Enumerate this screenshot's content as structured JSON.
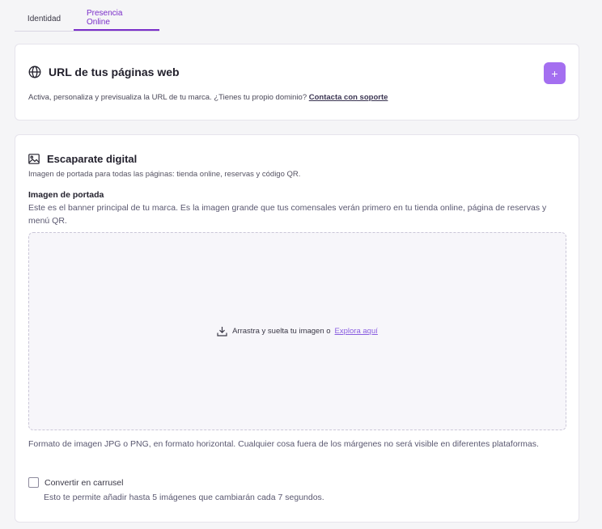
{
  "tabs": [
    {
      "label": "Identidad",
      "active": false
    },
    {
      "label": "Presencia Online",
      "active": true
    }
  ],
  "url_card": {
    "icon": "globe-icon",
    "title": "URL de tus páginas web",
    "add_button_label": "+",
    "description": "Activa, personaliza y previsualiza la URL de tu marca. ¿Tienes tu propio dominio?",
    "support_link": "Contacta con soporte"
  },
  "storefront_card": {
    "icon": "image-icon",
    "title": "Escaparate digital",
    "subtitle": "Imagen de portada para todas las páginas: tienda online, reservas y código QR.",
    "cover_label": "Imagen de portada",
    "cover_help": "Este es el banner principal de tu marca. Es la imagen grande que tus comensales verán primero en tu tienda online, página de reservas y menú QR.",
    "dropzone": {
      "icon": "download-icon",
      "text": "Arrastra y suelta tu imagen o",
      "link": "Explora aquí"
    },
    "format_help": "Formato de imagen JPG o PNG, en formato horizontal. Cualquier cosa fuera de los márgenes no será visible en diferentes plataformas.",
    "carousel": {
      "label": "Convertir en carrusel",
      "checked": false,
      "help": "Esto te permite añadir hasta 5 imágenes que cambiarán cada 7 segundos."
    }
  },
  "colors": {
    "accent": "#7b2fc9",
    "button": "#a46ff0",
    "link": "#8a5ee0"
  }
}
